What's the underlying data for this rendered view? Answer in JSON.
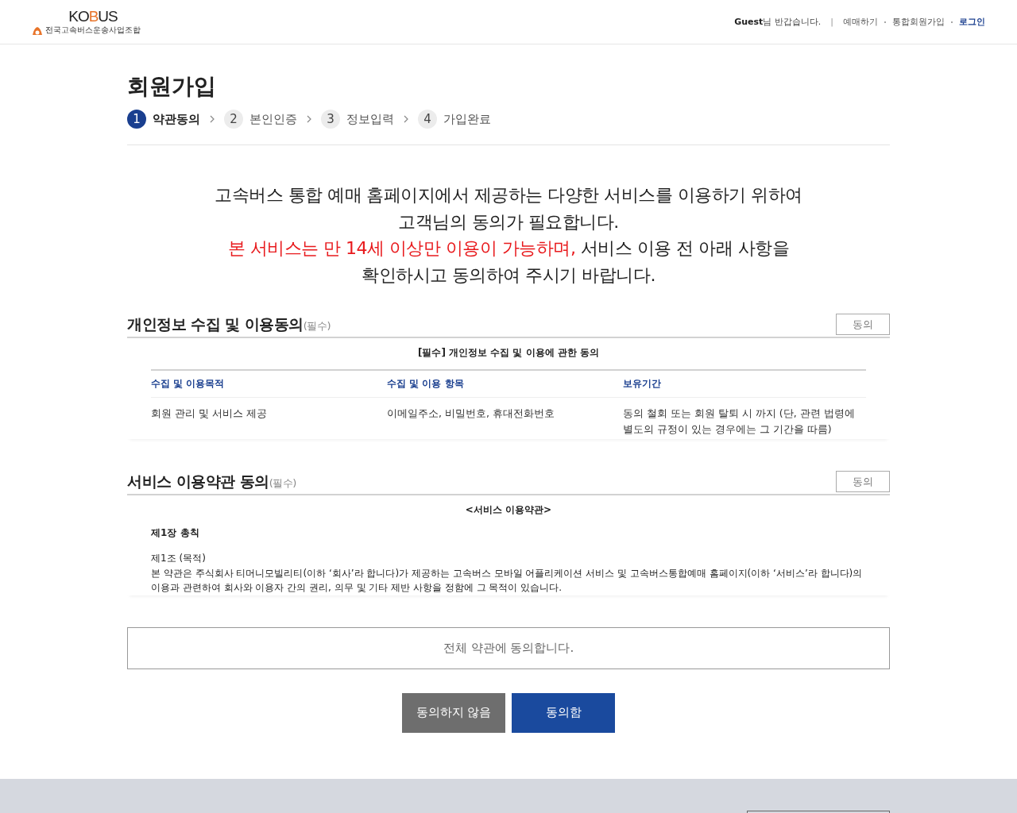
{
  "header": {
    "logo": {
      "name_parts": [
        {
          "text": "KO",
          "accent": false
        },
        {
          "text": "B",
          "accent": true
        },
        {
          "text": "US",
          "accent": false
        }
      ],
      "subtitle": "전국고속버스운송사업조합"
    },
    "greeting": "**Guest**님 반갑습니다.",
    "separator": "|",
    "links": [
      {
        "label": "예매하기",
        "kind": "plain"
      },
      {
        "label": "통합회원가입",
        "kind": "plain"
      },
      {
        "label": "로그인",
        "kind": "emphasis"
      }
    ]
  },
  "title": "회원가입",
  "steps": [
    {
      "number": "1",
      "label": "약관동의",
      "selected": true
    },
    {
      "number": "2",
      "label": "본인인증",
      "selected": false
    },
    {
      "number": "3",
      "label": "정보입력",
      "selected": false
    },
    {
      "number": "4",
      "label": "가입완료",
      "selected": false
    }
  ],
  "intro": [
    [
      {
        "text": "고속버스 통합 예매 홈페이지에서 제공하는 다양한 서비스를 이용하기 위하여",
        "alert": false
      }
    ],
    [
      {
        "text": "고객님의 동의가 필요합니다.",
        "alert": false
      }
    ],
    [
      {
        "text": "본 서비스는 만 14세 이상만 이용이 가능하며,",
        "alert": true
      },
      {
        "text": " 서비스 이용 전 아래 사항을",
        "alert": false
      }
    ],
    [
      {
        "text": "확인하시고 동의하여 주시기 바랍니다.",
        "alert": false
      }
    ]
  ],
  "sections": [
    {
      "kind": "table",
      "title": "개인정보 수집 및 이용동의",
      "tag": "(필수)",
      "button": "동의",
      "caption": "[필수] 개인정보 수집 및 이용에 관한 동의",
      "columns": [
        "수집 및 이용목적",
        "수집 및 이용 항목",
        "보유기간"
      ],
      "rows": [
        [
          "회원 관리 및 서비스 제공",
          "이메일주소, 비밀번호, 휴대전화번호",
          "동의 철회 또는 회원 탈퇴 시 까지 (단, 관련 법령에 별도의 규정이 있는 경우에는 그 기간을 따름)"
        ]
      ]
    },
    {
      "kind": "terms",
      "title": "서비스 이용약관 동의",
      "tag": "(필수)",
      "button": "동의",
      "caption": "<서비스 이용약관>",
      "chapter": "제1장 총칙",
      "article": "제1조 (목적)",
      "body": "본 약관은 주식회사 티머니모빌리티(이하 ‘회사’라 합니다)가 제공하는 고속버스 모바일 어플리케이션 서비스 및 고속버스통합예매 홈페이지(이하 ‘서비스’라 합니다)의 이용과 관련하여 회사와 이용자 간의 권리, 의무 및 기타 제반 사항을 정함에 그 목적이 있습니다."
    }
  ],
  "agree_all": "전체 약관에 동의합니다.",
  "buttons": [
    {
      "label": "동의하지 않음",
      "kind": "secondary"
    },
    {
      "label": "동의함",
      "kind": "primary"
    }
  ]
}
